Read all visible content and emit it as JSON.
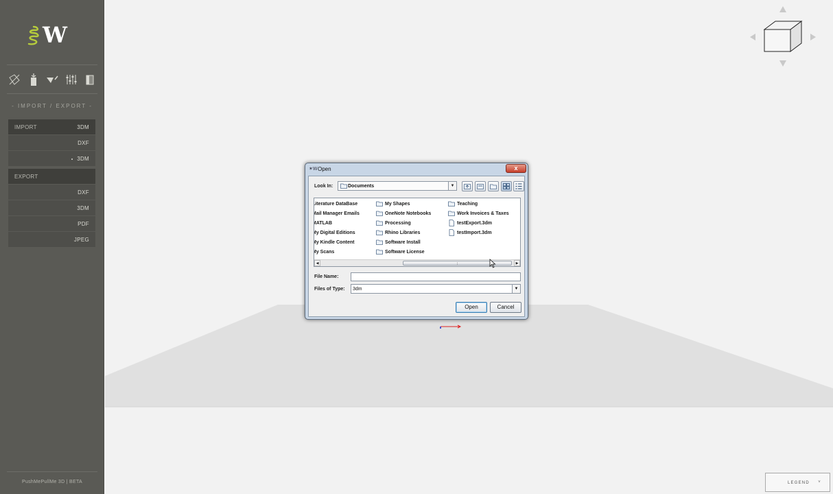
{
  "app": {
    "footer": "PushMePullMe 3D | BETA",
    "logo_letter": "W"
  },
  "sidebar": {
    "section_title": "- IMPORT / EXPORT -",
    "tools": [
      {
        "icon": "scale-tool-icon"
      },
      {
        "icon": "compress-tool-icon"
      },
      {
        "icon": "paint-bucket-icon"
      },
      {
        "icon": "sliders-icon"
      },
      {
        "icon": "export-panel-icon"
      }
    ],
    "import": {
      "label": "IMPORT",
      "header_value": "3DM",
      "items": [
        "DXF",
        "3DM"
      ]
    },
    "export": {
      "label": "EXPORT",
      "items": [
        "DXF",
        "3DM",
        "PDF",
        "JPEG"
      ]
    }
  },
  "viewport": {
    "legend_label": "LEGEND",
    "legend_chevron": "˅",
    "colors": {
      "background": "#f2f2f2",
      "ground": "#e0e0e0"
    }
  },
  "dialog": {
    "title": "Open",
    "title_icon": "✶W",
    "close_label": "x",
    "look_in_label": "Look In:",
    "look_in_value": "Documents",
    "toolbar_icons": [
      "up-folder-icon",
      "home-folder-icon",
      "new-folder-icon",
      "list-view-icon",
      "details-view-icon"
    ],
    "files": {
      "col1": [
        {
          "name": "Literature DataBase",
          "type": "folder"
        },
        {
          "name": "Mail Manager Emails",
          "type": "folder"
        },
        {
          "name": "MATLAB",
          "type": "folder"
        },
        {
          "name": "My Digital Editions",
          "type": "folder"
        },
        {
          "name": "My Kindle Content",
          "type": "folder"
        },
        {
          "name": "My Scans",
          "type": "folder"
        }
      ],
      "col2": [
        {
          "name": "My Shapes",
          "type": "folder"
        },
        {
          "name": "OneNote Notebooks",
          "type": "folder"
        },
        {
          "name": "Processing",
          "type": "folder"
        },
        {
          "name": "Rhino Libraries",
          "type": "folder"
        },
        {
          "name": "Software Install",
          "type": "folder"
        },
        {
          "name": "Software License",
          "type": "folder"
        }
      ],
      "col3": [
        {
          "name": "Teaching",
          "type": "folder"
        },
        {
          "name": "Work Invoices & Taxes",
          "type": "folder"
        },
        {
          "name": "testExport.3dm",
          "type": "file"
        },
        {
          "name": "testImport.3dm",
          "type": "file"
        }
      ]
    },
    "file_name_label": "File Name:",
    "file_name_value": "",
    "files_of_type_label": "Files of Type:",
    "files_of_type_value": "3dm",
    "open_label": "Open",
    "cancel_label": "Cancel"
  }
}
